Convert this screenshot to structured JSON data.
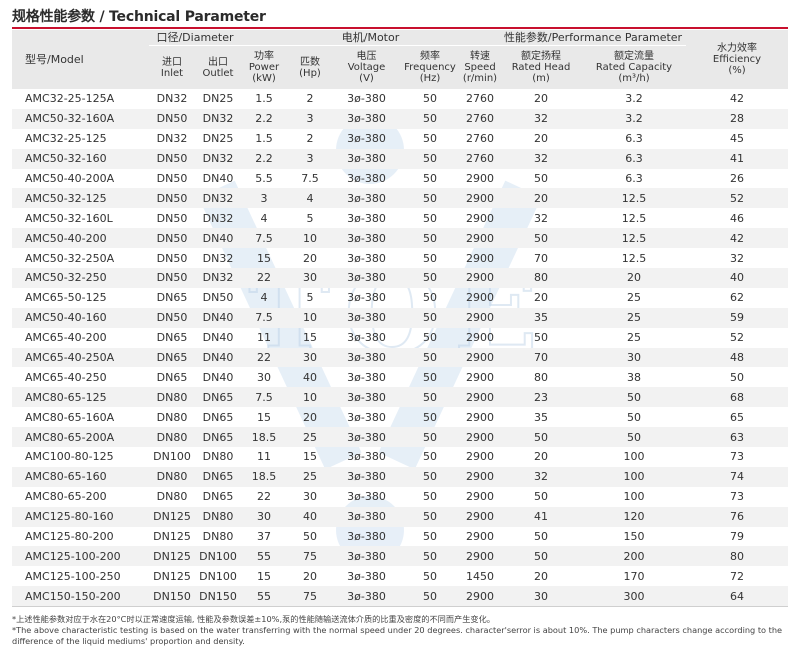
{
  "title": "规格性能参数 / Technical Parameter",
  "colors": {
    "accent": "#c8102e",
    "header_bg": "#e9e9e9",
    "stripe_bg": "#f2f2f2",
    "watermark": "#c9dcef"
  },
  "watermark_text": "TOE",
  "header": {
    "model": "型号/Model",
    "diameter_group": "口径/Diameter",
    "motor_group": "电机/Motor",
    "performance_group": "性能参数/Performance Parameter",
    "efficiency_cn": "水力效率",
    "efficiency_en": "Efficiency",
    "efficiency_unit": "(%)",
    "columns": {
      "inlet_cn": "进口",
      "inlet_en": "Inlet",
      "outlet_cn": "出口",
      "outlet_en": "Outlet",
      "power_cn": "功率",
      "power_en": "Power",
      "power_unit": "(kW)",
      "hp_cn": "匹数",
      "hp_unit": "(Hp)",
      "voltage_cn": "电压",
      "voltage_en": "Voltage",
      "voltage_unit": "(V)",
      "freq_cn": "频率",
      "freq_en": "Frequency",
      "freq_unit": "(Hz)",
      "speed_cn": "转速",
      "speed_en": "Speed",
      "speed_unit": "(r/min)",
      "head_cn": "额定扬程",
      "head_en": "Rated Head",
      "head_unit": "(m)",
      "cap_cn": "额定流量",
      "cap_en": "Rated Capacity",
      "cap_unit": "(m³/h)"
    }
  },
  "rows": [
    [
      "AMC32-25-125A",
      "DN32",
      "DN25",
      "1.5",
      "2",
      "3ø-380",
      "50",
      "2760",
      "20",
      "3.2",
      "42"
    ],
    [
      "AMC50-32-160A",
      "DN50",
      "DN32",
      "2.2",
      "3",
      "3ø-380",
      "50",
      "2760",
      "32",
      "3.2",
      "28"
    ],
    [
      "AMC32-25-125",
      "DN32",
      "DN25",
      "1.5",
      "2",
      "3ø-380",
      "50",
      "2760",
      "20",
      "6.3",
      "45"
    ],
    [
      "AMC50-32-160",
      "DN50",
      "DN32",
      "2.2",
      "3",
      "3ø-380",
      "50",
      "2760",
      "32",
      "6.3",
      "41"
    ],
    [
      "AMC50-40-200A",
      "DN50",
      "DN40",
      "5.5",
      "7.5",
      "3ø-380",
      "50",
      "2900",
      "50",
      "6.3",
      "26"
    ],
    [
      "AMC50-32-125",
      "DN50",
      "DN32",
      "3",
      "4",
      "3ø-380",
      "50",
      "2900",
      "20",
      "12.5",
      "52"
    ],
    [
      "AMC50-32-160L",
      "DN50",
      "DN32",
      "4",
      "5",
      "3ø-380",
      "50",
      "2900",
      "32",
      "12.5",
      "46"
    ],
    [
      "AMC50-40-200",
      "DN50",
      "DN40",
      "7.5",
      "10",
      "3ø-380",
      "50",
      "2900",
      "50",
      "12.5",
      "42"
    ],
    [
      "AMC50-32-250A",
      "DN50",
      "DN32",
      "15",
      "20",
      "3ø-380",
      "50",
      "2900",
      "70",
      "12.5",
      "32"
    ],
    [
      "AMC50-32-250",
      "DN50",
      "DN32",
      "22",
      "30",
      "3ø-380",
      "50",
      "2900",
      "80",
      "20",
      "40"
    ],
    [
      "AMC65-50-125",
      "DN65",
      "DN50",
      "4",
      "5",
      "3ø-380",
      "50",
      "2900",
      "20",
      "25",
      "62"
    ],
    [
      "AMC50-40-160",
      "DN50",
      "DN40",
      "7.5",
      "10",
      "3ø-380",
      "50",
      "2900",
      "35",
      "25",
      "59"
    ],
    [
      "AMC65-40-200",
      "DN65",
      "DN40",
      "11",
      "15",
      "3ø-380",
      "50",
      "2900",
      "50",
      "25",
      "52"
    ],
    [
      "AMC65-40-250A",
      "DN65",
      "DN40",
      "22",
      "30",
      "3ø-380",
      "50",
      "2900",
      "70",
      "30",
      "48"
    ],
    [
      "AMC65-40-250",
      "DN65",
      "DN40",
      "30",
      "40",
      "3ø-380",
      "50",
      "2900",
      "80",
      "38",
      "50"
    ],
    [
      "AMC80-65-125",
      "DN80",
      "DN65",
      "7.5",
      "10",
      "3ø-380",
      "50",
      "2900",
      "23",
      "50",
      "68"
    ],
    [
      "AMC80-65-160A",
      "DN80",
      "DN65",
      "15",
      "20",
      "3ø-380",
      "50",
      "2900",
      "35",
      "50",
      "65"
    ],
    [
      "AMC80-65-200A",
      "DN80",
      "DN65",
      "18.5",
      "25",
      "3ø-380",
      "50",
      "2900",
      "50",
      "50",
      "63"
    ],
    [
      "AMC100-80-125",
      "DN100",
      "DN80",
      "11",
      "15",
      "3ø-380",
      "50",
      "2900",
      "20",
      "100",
      "73"
    ],
    [
      "AMC80-65-160",
      "DN80",
      "DN65",
      "18.5",
      "25",
      "3ø-380",
      "50",
      "2900",
      "32",
      "100",
      "74"
    ],
    [
      "AMC80-65-200",
      "DN80",
      "DN65",
      "22",
      "30",
      "3ø-380",
      "50",
      "2900",
      "50",
      "100",
      "73"
    ],
    [
      "AMC125-80-160",
      "DN125",
      "DN80",
      "30",
      "40",
      "3ø-380",
      "50",
      "2900",
      "41",
      "120",
      "76"
    ],
    [
      "AMC125-80-200",
      "DN125",
      "DN80",
      "37",
      "50",
      "3ø-380",
      "50",
      "2900",
      "50",
      "150",
      "79"
    ],
    [
      "AMC125-100-200",
      "DN125",
      "DN100",
      "55",
      "75",
      "3ø-380",
      "50",
      "2900",
      "50",
      "200",
      "80"
    ],
    [
      "AMC125-100-250",
      "DN125",
      "DN100",
      "15",
      "20",
      "3ø-380",
      "50",
      "1450",
      "20",
      "170",
      "72"
    ],
    [
      "AMC150-150-200",
      "DN150",
      "DN150",
      "55",
      "75",
      "3ø-380",
      "50",
      "2900",
      "30",
      "300",
      "64"
    ]
  ],
  "notes": {
    "cn": "*上述性能参数对应于水在20°C时以正常速度运输, 性能及参数误差±10%,泵的性能随输送流体介质的比重及密度的不同而产生变化。",
    "en": "*The above characteristic testing is based on the water transferring with the normal speed under 20 degrees.  character'serror is about 10%. The pump characters change according to the difference of the liquid mediums' proportion and density."
  }
}
